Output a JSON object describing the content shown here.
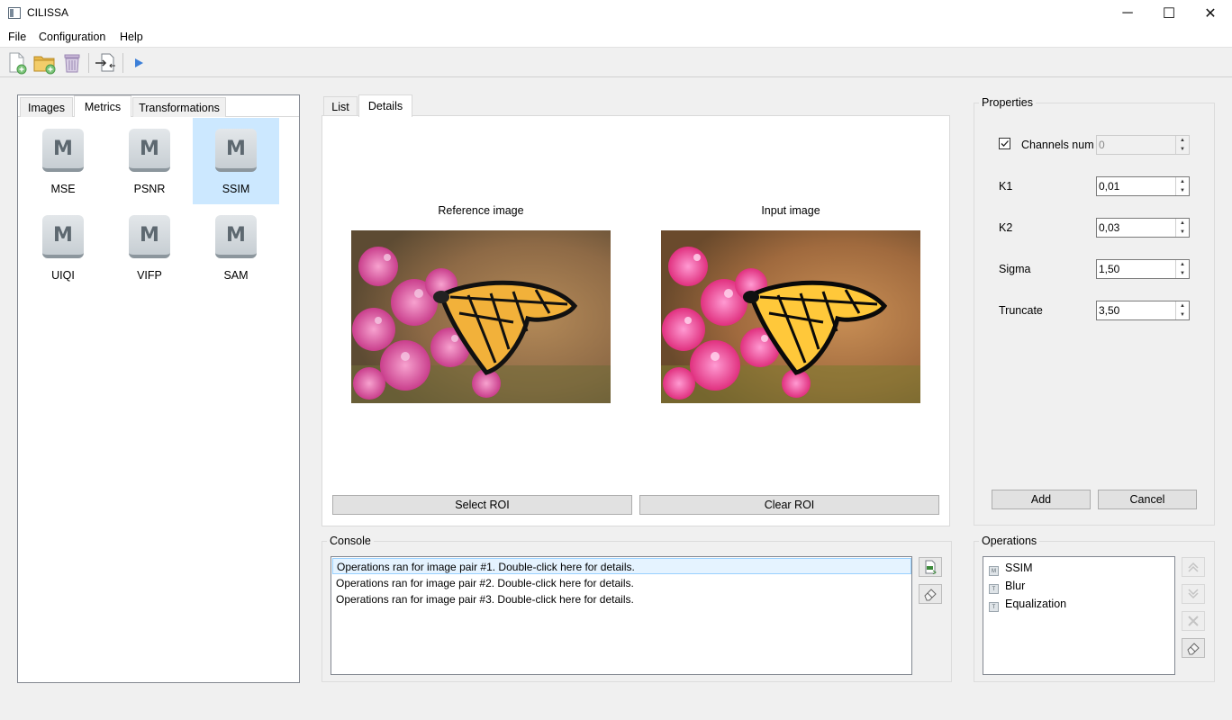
{
  "window": {
    "title": "CILISSA",
    "minimize": "─",
    "maximize": "☐",
    "close": "✕"
  },
  "menu": [
    "File",
    "Configuration",
    "Help"
  ],
  "toolbar": [
    "new-file-icon",
    "open-folder-icon",
    "trash-icon",
    "import-icon",
    "run-icon"
  ],
  "left_tabs": [
    "Images",
    "Metrics",
    "Transformations"
  ],
  "left_active_tab": "Metrics",
  "metrics": [
    {
      "icon_letter": "M",
      "label": "MSE"
    },
    {
      "icon_letter": "M",
      "label": "PSNR"
    },
    {
      "icon_letter": "M",
      "label": "SSIM",
      "selected": true
    },
    {
      "icon_letter": "M",
      "label": "UIQI"
    },
    {
      "icon_letter": "M",
      "label": "VIFP"
    },
    {
      "icon_letter": "M",
      "label": "SAM"
    }
  ],
  "center_tabs": [
    "List",
    "Details"
  ],
  "center_active_tab": "Details",
  "details": {
    "reference_caption": "Reference image",
    "input_caption": "Input image",
    "select_roi": "Select ROI",
    "clear_roi": "Clear ROI"
  },
  "properties": {
    "title": "Properties",
    "channels_num": {
      "label": "Channels num",
      "checked": true,
      "value": "0",
      "enabled": false
    },
    "fields": [
      {
        "label": "K1",
        "value": "0,01"
      },
      {
        "label": "K2",
        "value": "0,03"
      },
      {
        "label": "Sigma",
        "value": "1,50"
      },
      {
        "label": "Truncate",
        "value": "3,50"
      }
    ],
    "add_label": "Add",
    "cancel_label": "Cancel"
  },
  "console": {
    "title": "Console",
    "rows": [
      "Operations ran for image pair #1. Double-click here for details.",
      "Operations ran for image pair #2. Double-click here for details.",
      "Operations ran for image pair #3. Double-click here for details."
    ]
  },
  "operations": {
    "title": "Operations",
    "items": [
      {
        "label": "SSIM",
        "icon_letter": "M"
      },
      {
        "label": "Blur",
        "icon_letter": "T"
      },
      {
        "label": "Equalization",
        "icon_letter": "T"
      }
    ]
  },
  "colors": {
    "selection": "#cce8ff",
    "console_selection": "#e5f3ff",
    "run_icon": "#3c7fd8"
  }
}
